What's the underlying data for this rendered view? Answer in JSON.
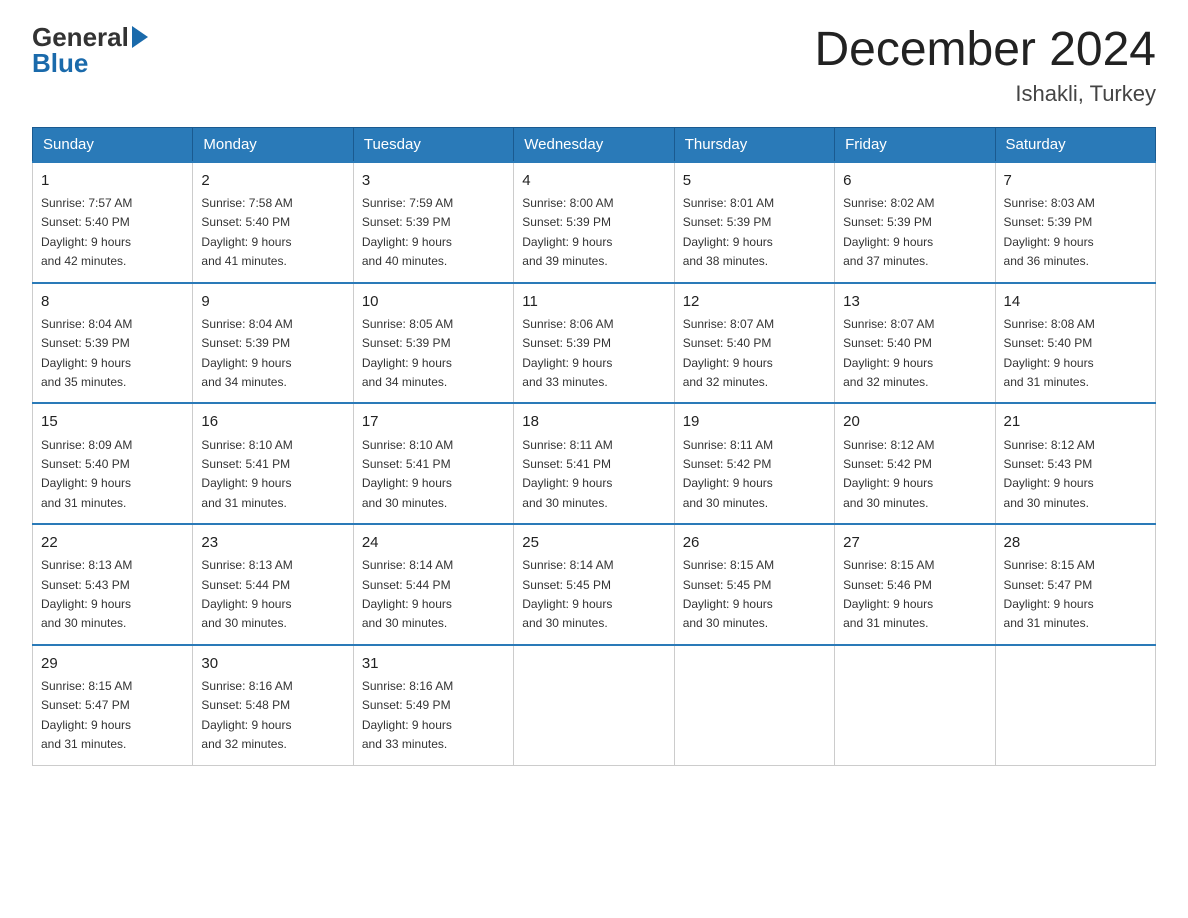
{
  "logo": {
    "general": "General",
    "blue": "Blue"
  },
  "header": {
    "month": "December 2024",
    "location": "Ishakli, Turkey"
  },
  "weekdays": [
    "Sunday",
    "Monday",
    "Tuesday",
    "Wednesday",
    "Thursday",
    "Friday",
    "Saturday"
  ],
  "weeks": [
    [
      {
        "day": "1",
        "sunrise": "7:57 AM",
        "sunset": "5:40 PM",
        "daylight": "9 hours and 42 minutes."
      },
      {
        "day": "2",
        "sunrise": "7:58 AM",
        "sunset": "5:40 PM",
        "daylight": "9 hours and 41 minutes."
      },
      {
        "day": "3",
        "sunrise": "7:59 AM",
        "sunset": "5:39 PM",
        "daylight": "9 hours and 40 minutes."
      },
      {
        "day": "4",
        "sunrise": "8:00 AM",
        "sunset": "5:39 PM",
        "daylight": "9 hours and 39 minutes."
      },
      {
        "day": "5",
        "sunrise": "8:01 AM",
        "sunset": "5:39 PM",
        "daylight": "9 hours and 38 minutes."
      },
      {
        "day": "6",
        "sunrise": "8:02 AM",
        "sunset": "5:39 PM",
        "daylight": "9 hours and 37 minutes."
      },
      {
        "day": "7",
        "sunrise": "8:03 AM",
        "sunset": "5:39 PM",
        "daylight": "9 hours and 36 minutes."
      }
    ],
    [
      {
        "day": "8",
        "sunrise": "8:04 AM",
        "sunset": "5:39 PM",
        "daylight": "9 hours and 35 minutes."
      },
      {
        "day": "9",
        "sunrise": "8:04 AM",
        "sunset": "5:39 PM",
        "daylight": "9 hours and 34 minutes."
      },
      {
        "day": "10",
        "sunrise": "8:05 AM",
        "sunset": "5:39 PM",
        "daylight": "9 hours and 34 minutes."
      },
      {
        "day": "11",
        "sunrise": "8:06 AM",
        "sunset": "5:39 PM",
        "daylight": "9 hours and 33 minutes."
      },
      {
        "day": "12",
        "sunrise": "8:07 AM",
        "sunset": "5:40 PM",
        "daylight": "9 hours and 32 minutes."
      },
      {
        "day": "13",
        "sunrise": "8:07 AM",
        "sunset": "5:40 PM",
        "daylight": "9 hours and 32 minutes."
      },
      {
        "day": "14",
        "sunrise": "8:08 AM",
        "sunset": "5:40 PM",
        "daylight": "9 hours and 31 minutes."
      }
    ],
    [
      {
        "day": "15",
        "sunrise": "8:09 AM",
        "sunset": "5:40 PM",
        "daylight": "9 hours and 31 minutes."
      },
      {
        "day": "16",
        "sunrise": "8:10 AM",
        "sunset": "5:41 PM",
        "daylight": "9 hours and 31 minutes."
      },
      {
        "day": "17",
        "sunrise": "8:10 AM",
        "sunset": "5:41 PM",
        "daylight": "9 hours and 30 minutes."
      },
      {
        "day": "18",
        "sunrise": "8:11 AM",
        "sunset": "5:41 PM",
        "daylight": "9 hours and 30 minutes."
      },
      {
        "day": "19",
        "sunrise": "8:11 AM",
        "sunset": "5:42 PM",
        "daylight": "9 hours and 30 minutes."
      },
      {
        "day": "20",
        "sunrise": "8:12 AM",
        "sunset": "5:42 PM",
        "daylight": "9 hours and 30 minutes."
      },
      {
        "day": "21",
        "sunrise": "8:12 AM",
        "sunset": "5:43 PM",
        "daylight": "9 hours and 30 minutes."
      }
    ],
    [
      {
        "day": "22",
        "sunrise": "8:13 AM",
        "sunset": "5:43 PM",
        "daylight": "9 hours and 30 minutes."
      },
      {
        "day": "23",
        "sunrise": "8:13 AM",
        "sunset": "5:44 PM",
        "daylight": "9 hours and 30 minutes."
      },
      {
        "day": "24",
        "sunrise": "8:14 AM",
        "sunset": "5:44 PM",
        "daylight": "9 hours and 30 minutes."
      },
      {
        "day": "25",
        "sunrise": "8:14 AM",
        "sunset": "5:45 PM",
        "daylight": "9 hours and 30 minutes."
      },
      {
        "day": "26",
        "sunrise": "8:15 AM",
        "sunset": "5:45 PM",
        "daylight": "9 hours and 30 minutes."
      },
      {
        "day": "27",
        "sunrise": "8:15 AM",
        "sunset": "5:46 PM",
        "daylight": "9 hours and 31 minutes."
      },
      {
        "day": "28",
        "sunrise": "8:15 AM",
        "sunset": "5:47 PM",
        "daylight": "9 hours and 31 minutes."
      }
    ],
    [
      {
        "day": "29",
        "sunrise": "8:15 AM",
        "sunset": "5:47 PM",
        "daylight": "9 hours and 31 minutes."
      },
      {
        "day": "30",
        "sunrise": "8:16 AM",
        "sunset": "5:48 PM",
        "daylight": "9 hours and 32 minutes."
      },
      {
        "day": "31",
        "sunrise": "8:16 AM",
        "sunset": "5:49 PM",
        "daylight": "9 hours and 33 minutes."
      },
      null,
      null,
      null,
      null
    ]
  ]
}
